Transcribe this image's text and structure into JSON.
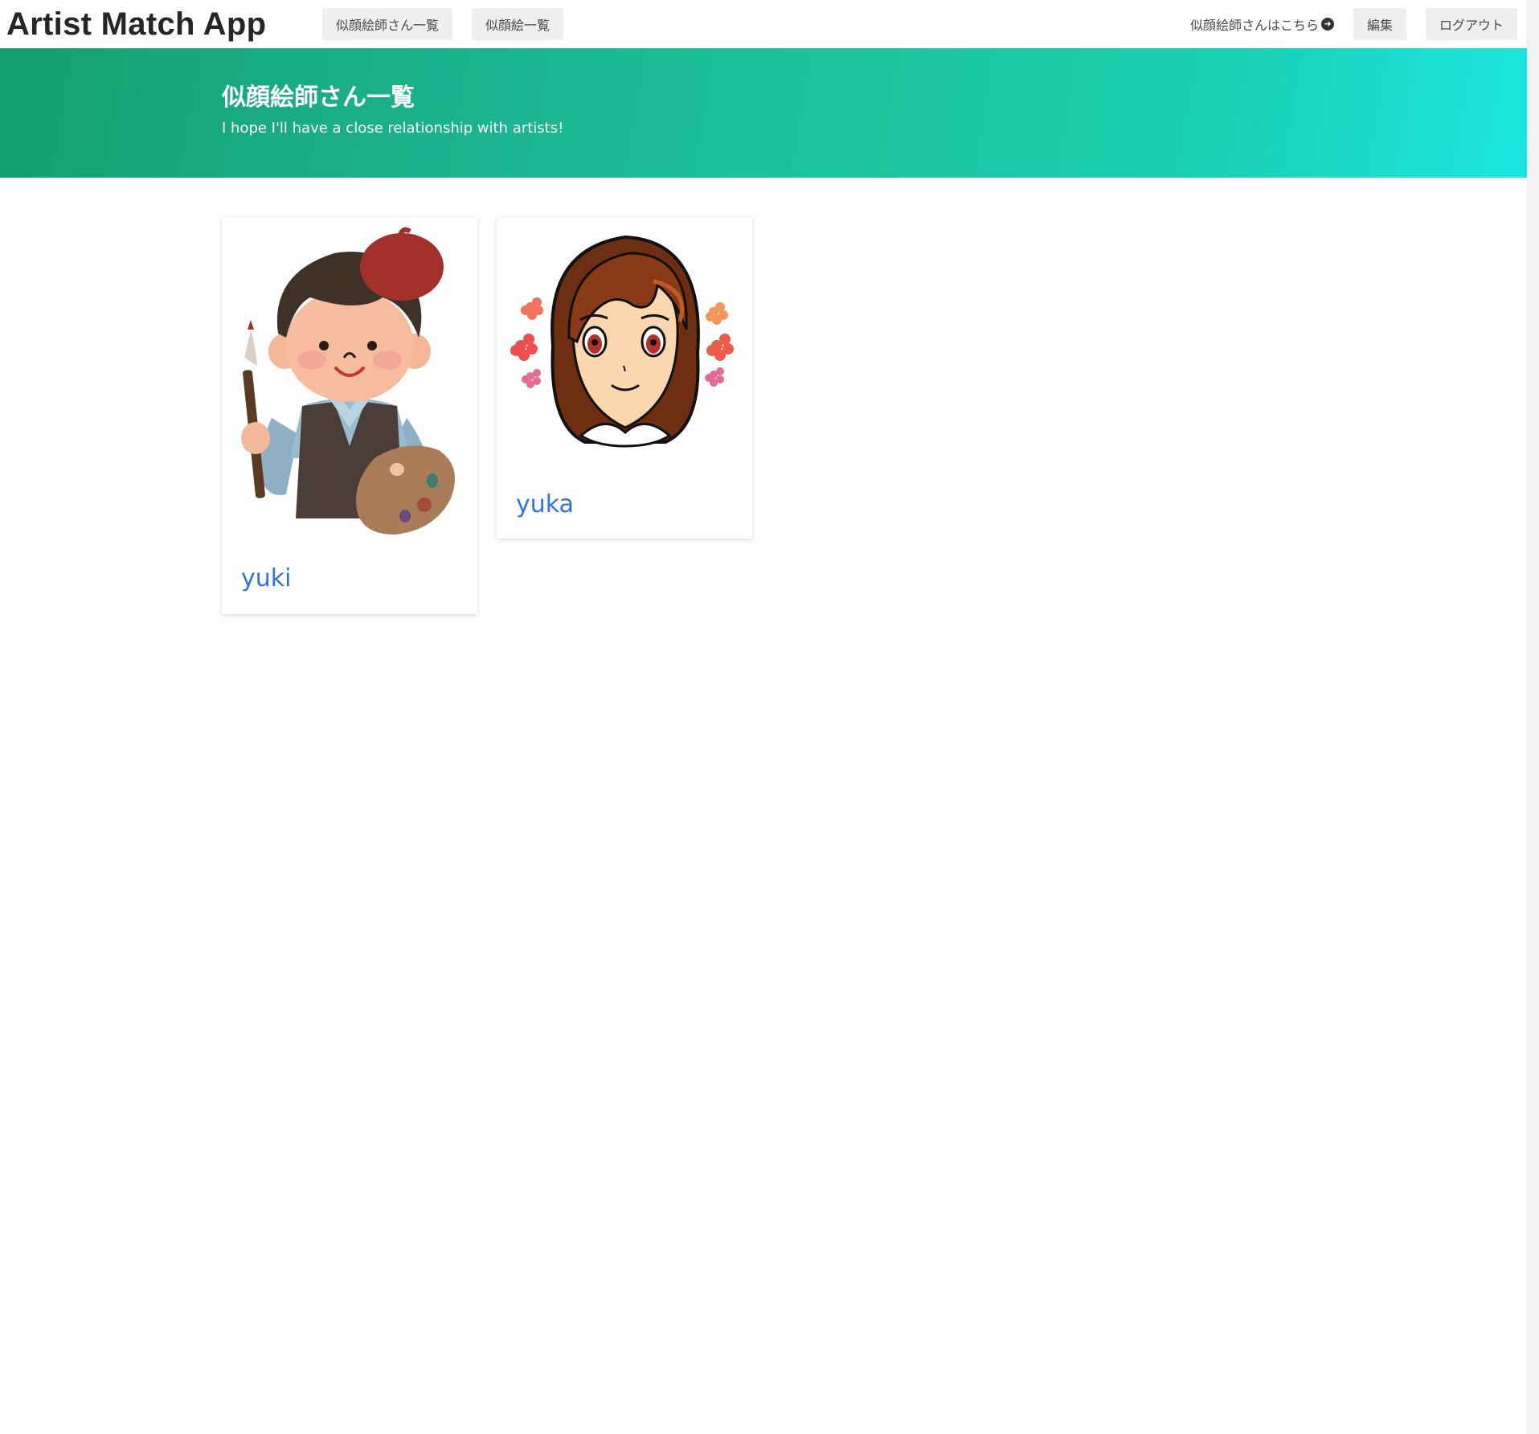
{
  "navbar": {
    "brand": "Artist Match App",
    "links": {
      "artists_list": "似顔絵師さん一覧",
      "portraits_list": "似顔絵一覧",
      "for_artists": "似顔絵師さんはこちら",
      "edit": "編集",
      "logout": "ログアウト"
    },
    "icons": {
      "for_artists": "arrow-circle-right-icon"
    }
  },
  "hero": {
    "title": "似顔絵師さん一覧",
    "subtitle": "I hope I'll have a close relationship with artists!",
    "gradient_colors": [
      "#159e6e",
      "#1cc39b",
      "#1ce6e1"
    ]
  },
  "artists": [
    {
      "name": "yuki",
      "image": "boy-painter-with-beret-illustration"
    },
    {
      "name": "yuka",
      "image": "girl-portrait-with-flowers-illustration"
    }
  ],
  "colors": {
    "link": "#3273dc",
    "button_bg": "#efefef",
    "text": "#4a4a4a"
  }
}
